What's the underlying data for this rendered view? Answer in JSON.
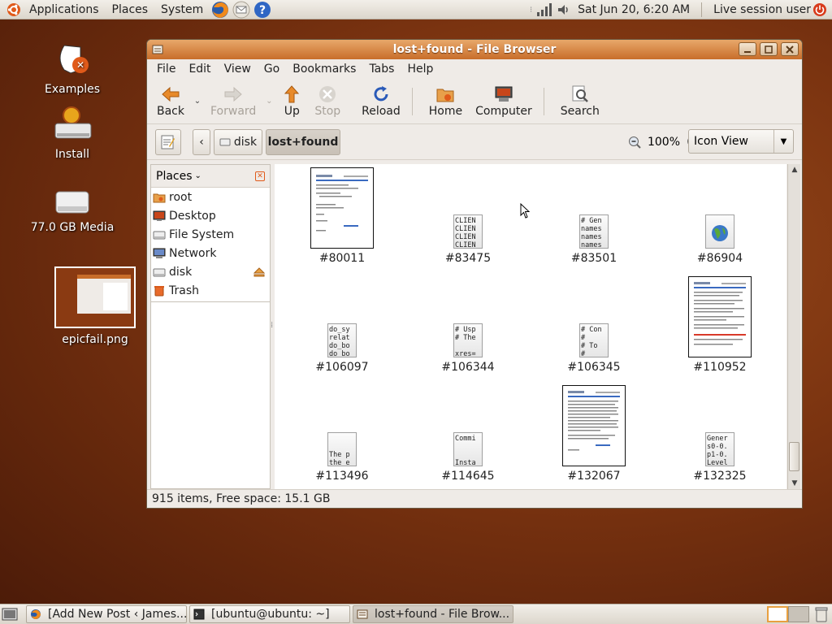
{
  "top_panel": {
    "menus": [
      "Applications",
      "Places",
      "System"
    ],
    "clock": "Sat Jun 20,  6:20 AM",
    "user": "Live session user"
  },
  "desktop": {
    "icons": [
      {
        "label": "Examples"
      },
      {
        "label": "Install"
      },
      {
        "label": "77.0 GB Media"
      },
      {
        "label": "epicfail.png"
      }
    ]
  },
  "window": {
    "title": "lost+found - File Browser",
    "menu": [
      "File",
      "Edit",
      "View",
      "Go",
      "Bookmarks",
      "Tabs",
      "Help"
    ],
    "toolbar": {
      "back": "Back",
      "forward": "Forward",
      "up": "Up",
      "stop": "Stop",
      "reload": "Reload",
      "home": "Home",
      "computer": "Computer",
      "search": "Search"
    },
    "location": {
      "crumbs": [
        "disk",
        "lost+found"
      ],
      "zoom": "100%",
      "view_mode": "Icon View"
    },
    "sidebar": {
      "title": "Places",
      "items": [
        "root",
        "Desktop",
        "File System",
        "Network",
        "disk",
        "Trash"
      ]
    },
    "files": [
      {
        "name": "#80011",
        "kind": "doc",
        "preview": ""
      },
      {
        "name": "#83475",
        "kind": "text",
        "preview": "CLIEN\nCLIEN\nCLIEN\nCLIEN"
      },
      {
        "name": "#83501",
        "kind": "text",
        "preview": "# Gen\nnames\nnames\nnames"
      },
      {
        "name": "#86904",
        "kind": "html",
        "preview": ""
      },
      {
        "name": "#106097",
        "kind": "text",
        "preview": "do_sy\nrelat\ndo_bo\ndo_bo"
      },
      {
        "name": "#106344",
        "kind": "text",
        "preview": "# Usp\n# The\n\nxres="
      },
      {
        "name": "#106345",
        "kind": "text",
        "preview": "# Con\n#\n# To\n#"
      },
      {
        "name": "#110952",
        "kind": "doc",
        "preview": ""
      },
      {
        "name": "#113496",
        "kind": "text",
        "preview": "\n\nThe p\nthe e"
      },
      {
        "name": "#114645",
        "kind": "text",
        "preview": "Commi\n\n\nInsta"
      },
      {
        "name": "#132067",
        "kind": "doc",
        "preview": ""
      },
      {
        "name": "#132325",
        "kind": "text",
        "preview": "Gener\ns0-0.\np1-0.\nLevel"
      }
    ],
    "status": "915 items, Free space: 15.1 GB"
  },
  "bottom_panel": {
    "tasks": [
      "[Add New Post ‹ James...",
      "[ubuntu@ubuntu: ~]",
      "lost+found - File Brow..."
    ]
  }
}
